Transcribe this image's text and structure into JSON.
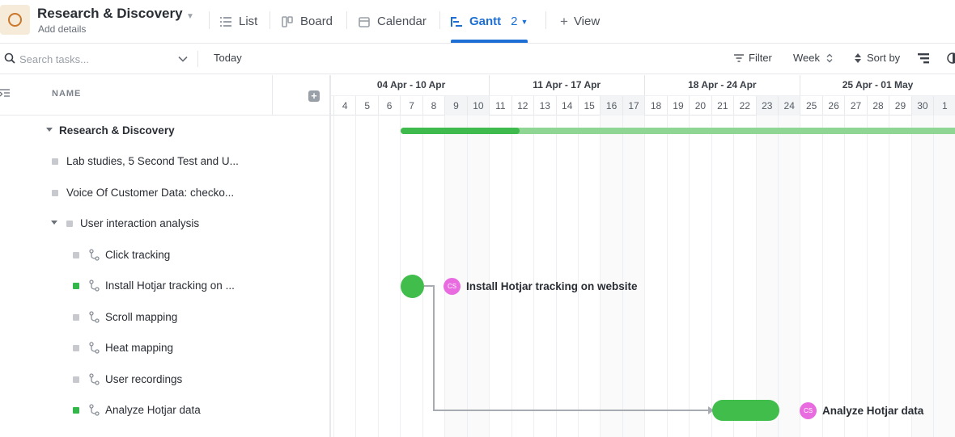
{
  "header": {
    "space_title": "Research & Discovery",
    "add_details": "Add details",
    "tabs": [
      {
        "label": "List",
        "icon": "list-icon"
      },
      {
        "label": "Board",
        "icon": "board-icon"
      },
      {
        "label": "Calendar",
        "icon": "calendar-icon"
      },
      {
        "label": "Gantt",
        "icon": "gantt-icon",
        "count": "2",
        "active": true
      }
    ],
    "add_view": "View",
    "colors": {
      "accent": "#1d6fd6",
      "space_icon": "#c9772a"
    }
  },
  "toolbar": {
    "search_placeholder": "Search tasks...",
    "today": "Today",
    "filter": "Filter",
    "week": "Week",
    "sort": "Sort by"
  },
  "task_list": {
    "name_header": "NAME",
    "group": "Research & Discovery",
    "tasks": [
      {
        "name": "Lab studies, 5 Second Test and U...",
        "status_color": "#c7c9ce"
      },
      {
        "name": "Voice Of Customer Data: checko...",
        "status_color": "#c7c9ce"
      },
      {
        "name": "User interaction analysis",
        "status_color": "#c7c9ce"
      }
    ],
    "subtasks": [
      {
        "name": "Click tracking",
        "status_color": "#c7c9ce"
      },
      {
        "name": "Install Hotjar tracking on ...",
        "status_color": "#33b64a"
      },
      {
        "name": "Scroll mapping",
        "status_color": "#c7c9ce"
      },
      {
        "name": "Heat mapping",
        "status_color": "#c7c9ce"
      },
      {
        "name": "User recordings",
        "status_color": "#c7c9ce"
      },
      {
        "name": "Analyze Hotjar data",
        "status_color": "#33b64a"
      }
    ]
  },
  "gantt": {
    "weeks": [
      "04 Apr - 10 Apr",
      "11 Apr - 17 Apr",
      "18 Apr - 24 Apr",
      "25 Apr - 01 May"
    ],
    "days": [
      "4",
      "5",
      "6",
      "7",
      "8",
      "9",
      "10",
      "11",
      "12",
      "13",
      "14",
      "15",
      "16",
      "17",
      "18",
      "19",
      "20",
      "21",
      "22",
      "23",
      "24",
      "25",
      "26",
      "27",
      "28",
      "29",
      "30",
      "1"
    ],
    "bars": {
      "milestone_avatar": "CS",
      "milestone_label": "Install Hotjar tracking on website",
      "task_avatar": "CS",
      "task_label": "Analyze Hotjar data"
    },
    "colors": {
      "bar": "#41bd4c",
      "bar_light": "#8fd694",
      "avatar": "#e86be0"
    }
  }
}
